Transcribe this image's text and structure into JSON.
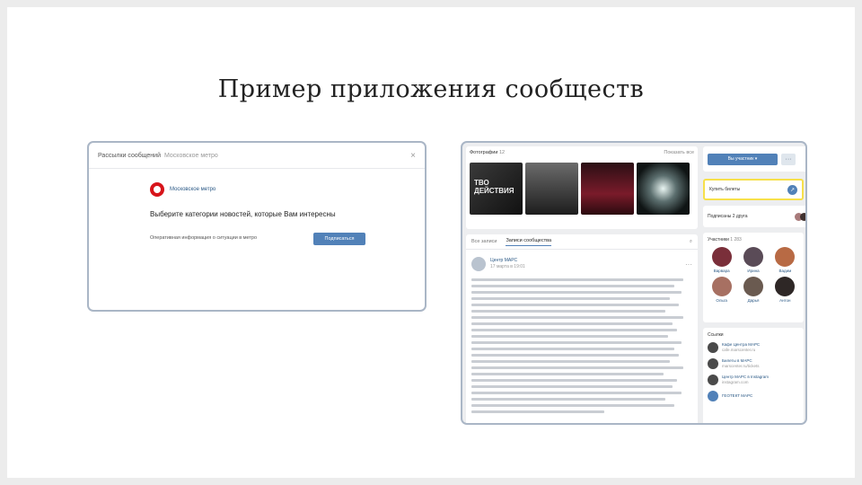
{
  "slide_title": "Пример приложения сообществ",
  "left": {
    "dialog_title": "Рассылки сообщений",
    "dialog_subtitle": "Московское метро",
    "close_glyph": "×",
    "community_name": "Московское метро",
    "question": "Выберите категории новостей, которые Вам интересны",
    "option_text": "Оперативная информация о ситуации в метро",
    "subscribe_label": "Подписаться"
  },
  "right": {
    "photos_label": "Фотографии",
    "photos_count": "12",
    "show_all": "Показать все",
    "photo1_caption": "ТВО ДЕЙСТВИЯ",
    "tabs": [
      "Все записи",
      "Записи сообщества"
    ],
    "search_glyph": "⌕",
    "post_author": "Центр МАРС",
    "post_date": "17 марта в 19:01",
    "post_menu": "···",
    "join_label": "Вы участник ▾",
    "more_glyph": "···",
    "tickets_label": "Купить билеты",
    "tickets_go": "↗",
    "friends_label": "Подписаны 2 друга",
    "members_label": "Участники",
    "members_count": "1 283",
    "members": [
      "Варвара",
      "Ирина",
      "Вадим",
      "Ольга",
      "Дарья",
      "Антон"
    ],
    "links_label": "Ссылки",
    "links": [
      {
        "title": "Кафе Центра МАРС",
        "sub": "cafe.marscenter.ru"
      },
      {
        "title": "Билеты в МАРС",
        "sub": "marscenter.ru/tickets"
      },
      {
        "title": "Центр МАРС в Instagram",
        "sub": "instagram.com"
      },
      {
        "title": "ГЕОТЕКТ МАРС",
        "sub": ""
      }
    ]
  },
  "colors": {
    "accent": "#5181b8",
    "highlight": "#f7e04b",
    "frame": "#aab6c6"
  }
}
